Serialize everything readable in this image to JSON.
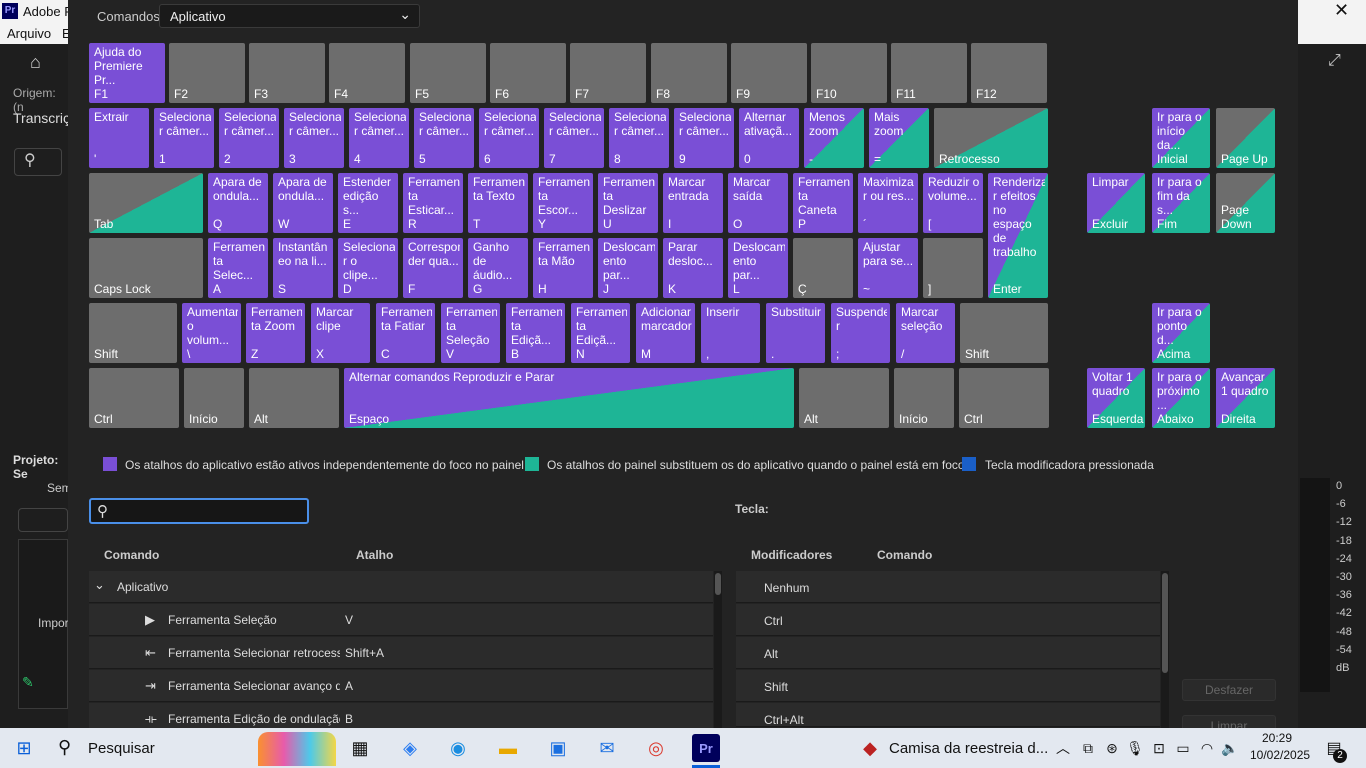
{
  "app": {
    "title_fragment": "Adobe P",
    "menu": [
      "Arquivo",
      "E"
    ]
  },
  "bgleft": {
    "origin": "Origem: (n",
    "transcript": "Transcriç",
    "project": "Projeto: Se",
    "sem": "Sem",
    "import": "Impor"
  },
  "dialog": {
    "commands_label": "Comandos:",
    "preset": "Aplicativo"
  },
  "keys": [
    {
      "cmd": "Ajuda do Premiere Pr...",
      "lbl": "F1",
      "t": "p"
    },
    {
      "cmd": "",
      "lbl": "F2",
      "t": "n"
    },
    {
      "cmd": "",
      "lbl": "F3",
      "t": "n"
    },
    {
      "cmd": "",
      "lbl": "F4",
      "t": "n"
    },
    {
      "cmd": "",
      "lbl": "F5",
      "t": "n"
    },
    {
      "cmd": "",
      "lbl": "F6",
      "t": "n"
    },
    {
      "cmd": "",
      "lbl": "F7",
      "t": "n"
    },
    {
      "cmd": "",
      "lbl": "F8",
      "t": "n"
    },
    {
      "cmd": "",
      "lbl": "F9",
      "t": "n"
    },
    {
      "cmd": "",
      "lbl": "F10",
      "t": "n"
    },
    {
      "cmd": "",
      "lbl": "F11",
      "t": "n"
    },
    {
      "cmd": "",
      "lbl": "F12",
      "t": "n"
    },
    {
      "cmd": "Extrair",
      "lbl": "'",
      "t": "p"
    },
    {
      "cmd": "Seleciona r câmer...",
      "lbl": "1",
      "t": "p"
    },
    {
      "cmd": "Seleciona r câmer...",
      "lbl": "2",
      "t": "p"
    },
    {
      "cmd": "Seleciona r câmer...",
      "lbl": "3",
      "t": "p"
    },
    {
      "cmd": "Seleciona r câmer...",
      "lbl": "4",
      "t": "p"
    },
    {
      "cmd": "Seleciona r câmer...",
      "lbl": "5",
      "t": "p"
    },
    {
      "cmd": "Seleciona r câmer...",
      "lbl": "6",
      "t": "p"
    },
    {
      "cmd": "Seleciona r câmer...",
      "lbl": "7",
      "t": "p"
    },
    {
      "cmd": "Seleciona r câmer...",
      "lbl": "8",
      "t": "p"
    },
    {
      "cmd": "Seleciona r câmer...",
      "lbl": "9",
      "t": "p"
    },
    {
      "cmd": "Alternar ativaçã...",
      "lbl": "0",
      "t": "p"
    },
    {
      "cmd": "Menos zoom",
      "lbl": "-",
      "t": "pg"
    },
    {
      "cmd": "Mais zoom",
      "lbl": "=",
      "t": "pg"
    },
    {
      "cmd": "",
      "lbl": "Retrocesso",
      "t": "gg"
    },
    {
      "cmd": "Ir para o início da...",
      "lbl": "Inicial",
      "t": "pg"
    },
    {
      "cmd": "",
      "lbl": "Page Up",
      "t": "gg"
    },
    {
      "cmd": "",
      "lbl": "Tab",
      "t": "gg"
    },
    {
      "cmd": "Apara de ondula...",
      "lbl": "Q",
      "t": "p"
    },
    {
      "cmd": "Apara de ondula...",
      "lbl": "W",
      "t": "p"
    },
    {
      "cmd": "Estender edição s...",
      "lbl": "E",
      "t": "p"
    },
    {
      "cmd": "Ferramen ta Esticar...",
      "lbl": "R",
      "t": "p"
    },
    {
      "cmd": "Ferramen ta Texto",
      "lbl": "T",
      "t": "p"
    },
    {
      "cmd": "Ferramen ta Escor...",
      "lbl": "Y",
      "t": "p"
    },
    {
      "cmd": "Ferramen ta Deslizar",
      "lbl": "U",
      "t": "p"
    },
    {
      "cmd": "Marcar entrada",
      "lbl": "I",
      "t": "p"
    },
    {
      "cmd": "Marcar saída",
      "lbl": "O",
      "t": "p"
    },
    {
      "cmd": "Ferramen ta Caneta",
      "lbl": "P",
      "t": "p"
    },
    {
      "cmd": "Maximiza r ou res...",
      "lbl": "´",
      "t": "p"
    },
    {
      "cmd": "Reduzir o volume...",
      "lbl": "[",
      "t": "p"
    },
    {
      "cmd": "Renderiza r efeitos no espaço de trabalho",
      "lbl": "Enter",
      "t": "pg"
    },
    {
      "cmd": "Limpar",
      "lbl": "Excluir",
      "t": "pg"
    },
    {
      "cmd": "Ir para o fim da s...",
      "lbl": "Fim",
      "t": "pg"
    },
    {
      "cmd": "",
      "lbl": "Page Down",
      "t": "gg"
    },
    {
      "cmd": "",
      "lbl": "Caps Lock",
      "t": "n"
    },
    {
      "cmd": "Ferramen ta Selec...",
      "lbl": "A",
      "t": "p"
    },
    {
      "cmd": "Instantân eo na li...",
      "lbl": "S",
      "t": "p"
    },
    {
      "cmd": "Seleciona r o clipe...",
      "lbl": "D",
      "t": "p"
    },
    {
      "cmd": "Correspon der qua...",
      "lbl": "F",
      "t": "p"
    },
    {
      "cmd": "Ganho de áudio...",
      "lbl": "G",
      "t": "p"
    },
    {
      "cmd": "Ferramen ta Mão",
      "lbl": "H",
      "t": "p"
    },
    {
      "cmd": "Deslocam ento par...",
      "lbl": "J",
      "t": "p"
    },
    {
      "cmd": "Parar desloc...",
      "lbl": "K",
      "t": "p"
    },
    {
      "cmd": "Deslocam ento par...",
      "lbl": "L",
      "t": "p"
    },
    {
      "cmd": "",
      "lbl": "Ç",
      "t": "n"
    },
    {
      "cmd": "Ajustar para se...",
      "lbl": "~",
      "t": "p"
    },
    {
      "cmd": "",
      "lbl": "]",
      "t": "n"
    },
    {
      "cmd": "",
      "lbl": "Shift",
      "t": "n"
    },
    {
      "cmd": "Aumentar o volum...",
      "lbl": "\\",
      "t": "p"
    },
    {
      "cmd": "Ferramen ta Zoom",
      "lbl": "Z",
      "t": "p"
    },
    {
      "cmd": "Marcar clipe",
      "lbl": "X",
      "t": "p"
    },
    {
      "cmd": "Ferramen ta Fatiar",
      "lbl": "C",
      "t": "p"
    },
    {
      "cmd": "Ferramen ta Seleção",
      "lbl": "V",
      "t": "p"
    },
    {
      "cmd": "Ferramen ta Ediçã...",
      "lbl": "B",
      "t": "p"
    },
    {
      "cmd": "Ferramen ta Ediçã...",
      "lbl": "N",
      "t": "p"
    },
    {
      "cmd": "Adicionar marcador",
      "lbl": "M",
      "t": "p"
    },
    {
      "cmd": "Inserir",
      "lbl": ",",
      "t": "p"
    },
    {
      "cmd": "Substituir",
      "lbl": ".",
      "t": "p"
    },
    {
      "cmd": "Suspende r",
      "lbl": ";",
      "t": "p"
    },
    {
      "cmd": "Marcar seleção",
      "lbl": "/",
      "t": "p"
    },
    {
      "cmd": "",
      "lbl": "Shift",
      "t": "n"
    },
    {
      "cmd": "Ir para o ponto d...",
      "lbl": "Acima",
      "t": "pg"
    },
    {
      "cmd": "",
      "lbl": "Ctrl",
      "t": "n"
    },
    {
      "cmd": "",
      "lbl": "Início",
      "t": "n"
    },
    {
      "cmd": "",
      "lbl": "Alt",
      "t": "n"
    },
    {
      "cmd": "Alternar comandos Reproduzir e Parar",
      "lbl": "Espaço",
      "t": "pg"
    },
    {
      "cmd": "",
      "lbl": "Alt",
      "t": "n"
    },
    {
      "cmd": "",
      "lbl": "Início",
      "t": "n"
    },
    {
      "cmd": "",
      "lbl": "Ctrl",
      "t": "n"
    },
    {
      "cmd": "Voltar 1 quadro",
      "lbl": "Esquerda",
      "t": "pg"
    },
    {
      "cmd": "Ir para o próximo ...",
      "lbl": "Abaixo",
      "t": "pg"
    },
    {
      "cmd": "Avançar 1 quadro",
      "lbl": "Direita",
      "t": "pg"
    }
  ],
  "legend": {
    "app": "Os atalhos do aplicativo estão ativos independentemente do foco no painel",
    "panel": "Os atalhos do painel substituem os do aplicativo quando o painel está em foco",
    "modifier": "Tecla modificadora pressionada",
    "colors": {
      "app": "#7a4fd6",
      "panel": "#1eb596",
      "modifier": "#1a5fc8"
    }
  },
  "search": {
    "value": ""
  },
  "key_label": "Tecla:",
  "table": {
    "headers": {
      "command": "Comando",
      "shortcut": "Atalho"
    },
    "group": "Aplicativo",
    "rows": [
      {
        "name": "Ferramenta Seleção",
        "shortcut": "V"
      },
      {
        "name": "Ferramenta Selecionar retrocesso de",
        "shortcut": "Shift+A"
      },
      {
        "name": "Ferramenta Selecionar avanço de fa",
        "shortcut": "A"
      },
      {
        "name": "Ferramenta Edição de ondulação",
        "shortcut": "B"
      }
    ]
  },
  "modifiers": {
    "headers": {
      "mods": "Modificadores",
      "command": "Comando"
    },
    "rows": [
      "Nenhum",
      "Ctrl",
      "Alt",
      "Shift",
      "Ctrl+Alt"
    ]
  },
  "buttons": {
    "undo": "Desfazer",
    "clear": "Limpar"
  },
  "meter": {
    "ticks": [
      "0",
      "-6",
      "-12",
      "-18",
      "-24",
      "-30",
      "-36",
      "-42",
      "-48",
      "-54",
      "dB"
    ]
  },
  "taskbar": {
    "search": "Pesquisar",
    "notification": "Camisa da reestreia d...",
    "time": "20:29",
    "date": "10/02/2025",
    "badge": "2"
  }
}
